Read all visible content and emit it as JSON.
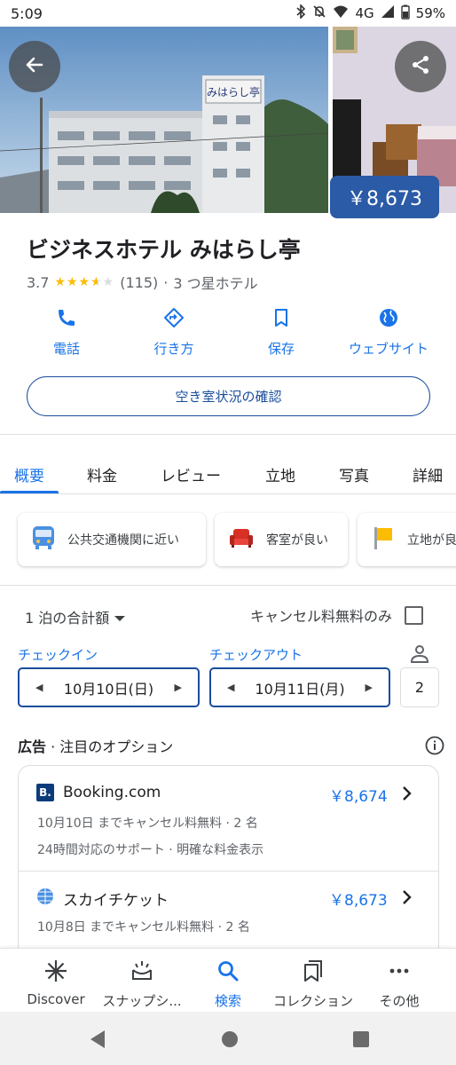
{
  "status": {
    "time": "5:09",
    "network": "4G",
    "battery": "59%"
  },
  "hotel": {
    "price_badge": "￥8,673",
    "name": "ビジネスホテル みはらし亭",
    "rating": "3.7",
    "rating_value": 3.7,
    "reviews": "(115)",
    "category": "3 つ星ホテル",
    "photo_sign": "みはらし亭"
  },
  "actions": [
    {
      "label": "電話",
      "icon": "phone-icon"
    },
    {
      "label": "行き方",
      "icon": "directions-icon"
    },
    {
      "label": "保存",
      "icon": "bookmark-icon"
    },
    {
      "label": "ウェブサイト",
      "icon": "globe-icon"
    }
  ],
  "availability_button": "空き室状況の確認",
  "tabs": [
    "概要",
    "料金",
    "レビュー",
    "立地",
    "写真",
    "詳細"
  ],
  "highlights": [
    {
      "label": "公共交通機関に近い",
      "icon": "bus-icon"
    },
    {
      "label": "客室が良い",
      "icon": "sofa-icon"
    },
    {
      "label": "立地が良",
      "icon": "flag-icon"
    }
  ],
  "pricing": {
    "nights_label": "1 泊の合計額",
    "free_cancel_only": "キャンセル料無料のみ",
    "checkin_label": "チェックイン",
    "checkin_date": "10月10日(日)",
    "checkout_label": "チェックアウト",
    "checkout_date": "10月11日(月)",
    "guests": "2"
  },
  "ads": {
    "ad_tag": "広告",
    "heading": " · 注目のオプション",
    "offers": [
      {
        "name": "Booking.com",
        "price": "￥8,674",
        "detail1": "10月10日 までキャンセル料無料 · 2 名",
        "detail2": "24時間対応のサポート · 明確な料金表示",
        "logo": "B."
      },
      {
        "name": "スカイチケット",
        "price": "￥8,673",
        "detail1": "10月8日 までキャンセル料無料 · 2 名"
      }
    ]
  },
  "bottom_nav": [
    {
      "label": "Discover",
      "icon": "asterisk-icon"
    },
    {
      "label": "スナップシ...",
      "icon": "snapshot-icon"
    },
    {
      "label": "検索",
      "icon": "search-icon"
    },
    {
      "label": "コレクション",
      "icon": "collections-icon"
    },
    {
      "label": "その他",
      "icon": "more-icon"
    }
  ],
  "colors": {
    "accent": "#1a73e8",
    "price_badge": "#2b5aa6",
    "outline": "#1a4d9c",
    "star": "#fbbc04"
  }
}
